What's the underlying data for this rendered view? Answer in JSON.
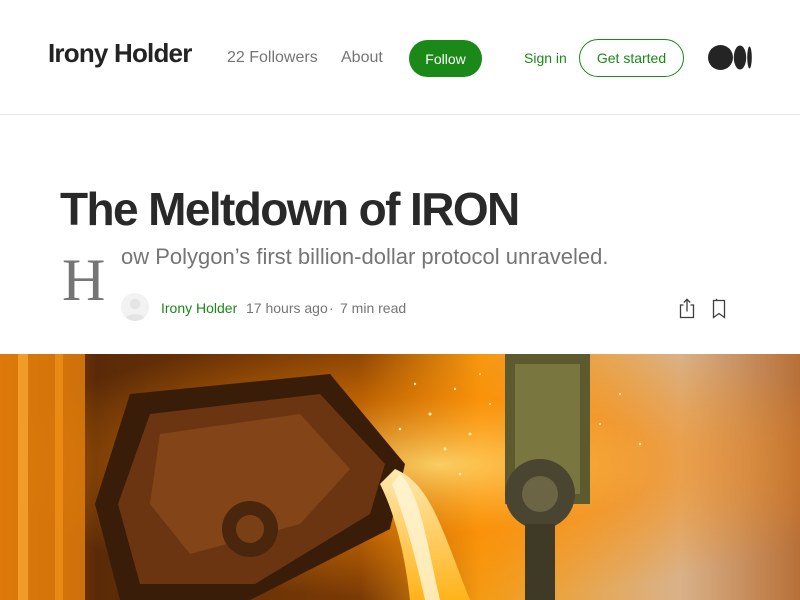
{
  "header": {
    "publication_name": "Irony Holder",
    "followers_label": "22 Followers",
    "about_label": "About",
    "follow_label": "Follow",
    "signin_label": "Sign in",
    "get_started_label": "Get started",
    "logo_icon": "medium-logo-icon"
  },
  "article": {
    "title": "The Meltdown of IRON",
    "dropcap": "H",
    "subtitle": "ow Polygon’s first billion-dollar protocol unraveled.",
    "author": "Irony Holder",
    "posted": "17 hours ago",
    "separator": "·",
    "read_time": "7 min read",
    "icons": [
      "avatar-placeholder-icon",
      "share-icon",
      "bookmark-icon"
    ]
  },
  "hero_image": {
    "subject": "molten-metal-pour",
    "colors": {
      "glow": "#ff8a00",
      "hot": "#ffe9b0",
      "dark": "#2a1505"
    }
  },
  "colors": {
    "accent": "#1a8917",
    "text": "#292929",
    "muted": "#757575",
    "border": "#e6e6e6"
  }
}
